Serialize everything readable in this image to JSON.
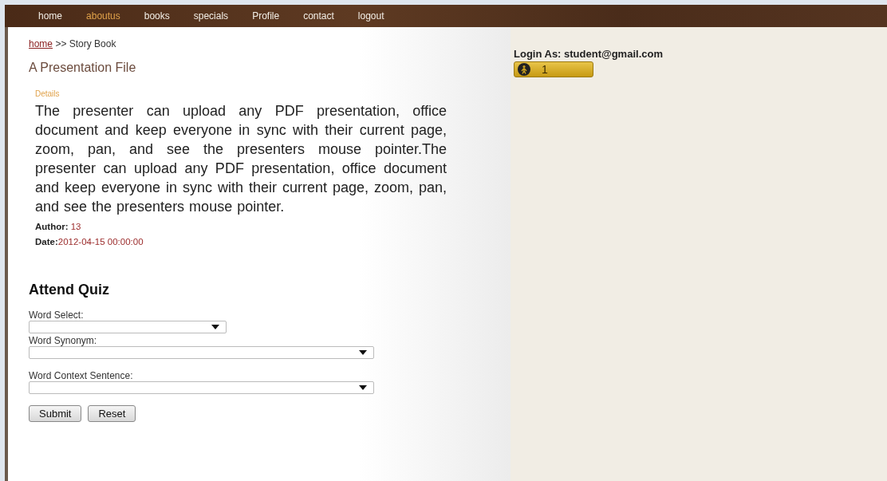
{
  "nav": [
    {
      "label": "home",
      "selected": false
    },
    {
      "label": "aboutus",
      "selected": true
    },
    {
      "label": "books",
      "selected": false
    },
    {
      "label": "specials",
      "selected": false
    },
    {
      "label": "Profile",
      "selected": false
    },
    {
      "label": "contact",
      "selected": false
    },
    {
      "label": "logout",
      "selected": false
    }
  ],
  "breadcrumb": {
    "link": "home",
    "rest": ">> Story Book"
  },
  "title": "A Presentation File",
  "details_label": "Details",
  "description": "The presenter can upload any PDF presentation, office document and keep everyone in sync with their current page, zoom, pan, and see the presenters mouse pointer.The presenter can upload any PDF presentation, office document and keep everyone in sync with their current page, zoom, pan, and see the presenters mouse pointer.",
  "author": {
    "label": "Author:",
    "value": "13"
  },
  "date": {
    "label": "Date:",
    "value": "2012-04-15 00:00:00"
  },
  "quiz": {
    "heading": "Attend Quiz",
    "fields": [
      {
        "label": "Word Select:",
        "kind": "short"
      },
      {
        "label": "Word Synonym:",
        "kind": "wide"
      },
      {
        "label": "Word Context Sentence:",
        "kind": "wide"
      }
    ],
    "buttons": [
      "Submit",
      "Reset"
    ]
  },
  "login": {
    "text": "Login As: student@gmail.com",
    "badge": "1"
  }
}
